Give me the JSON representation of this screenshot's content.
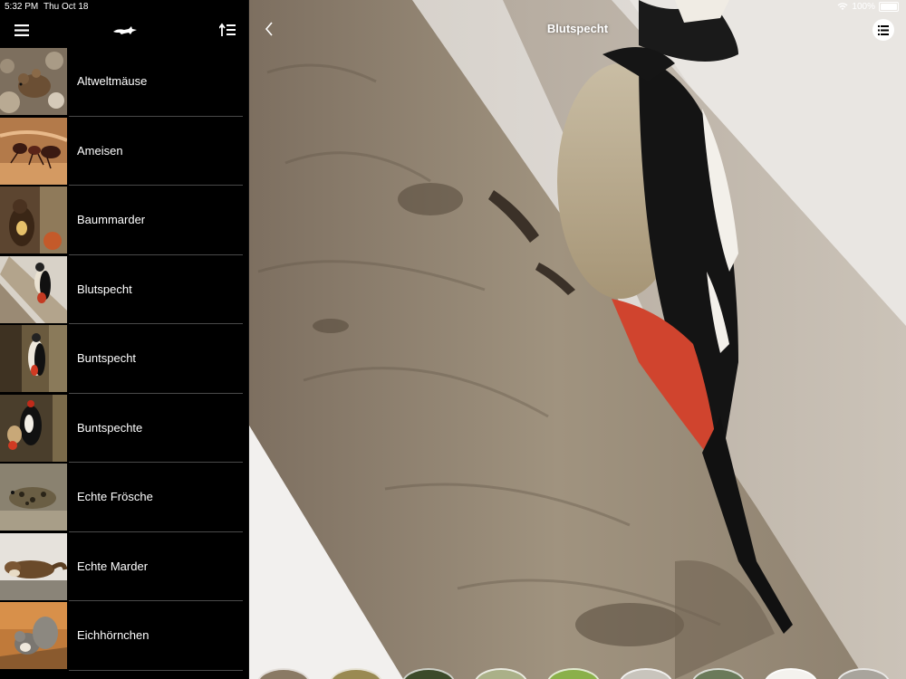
{
  "status_bar": {
    "time": "5:32 PM",
    "date": "Thu Oct 18",
    "battery": "100%"
  },
  "sidebar": {
    "icons": {
      "menu": "hamburger-menu-icon",
      "logo": "fox-logo-icon",
      "sort": "sort-list-icon"
    },
    "items": [
      {
        "label": "Altweltmäuse"
      },
      {
        "label": "Ameisen"
      },
      {
        "label": "Baummarder"
      },
      {
        "label": "Blutspecht"
      },
      {
        "label": "Buntspecht"
      },
      {
        "label": "Buntspechte"
      },
      {
        "label": "Echte Frösche"
      },
      {
        "label": "Echte Marder"
      },
      {
        "label": "Eichhörnchen"
      }
    ]
  },
  "detail": {
    "title": "Blutspecht",
    "icons": {
      "back": "chevron-left-icon",
      "list": "list-icon"
    }
  },
  "colors": {
    "background": "#000000",
    "separator": "#4a4a4a",
    "accent_white": "#ffffff"
  }
}
